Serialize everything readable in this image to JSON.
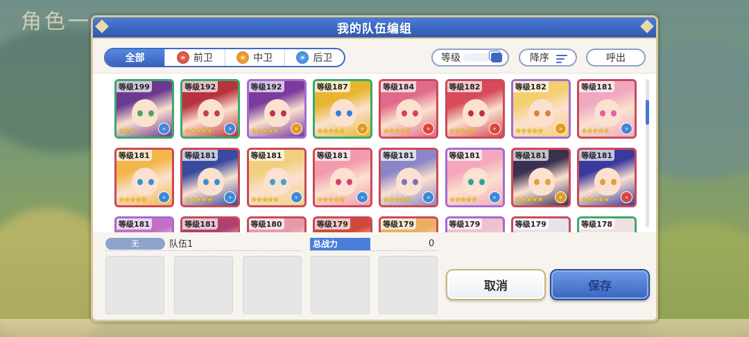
{
  "background_title": "角色一",
  "dialog": {
    "title": "我的队伍编组"
  },
  "tabs": [
    {
      "label": "全部",
      "active": true,
      "icon": ""
    },
    {
      "label": "前卫",
      "active": false,
      "icon": "front-role-icon"
    },
    {
      "label": "中卫",
      "active": false,
      "icon": "mid-role-icon"
    },
    {
      "label": "后卫",
      "active": false,
      "icon": "back-role-icon"
    }
  ],
  "sort": {
    "level_label": "等级",
    "order_label": "降序",
    "recall_label": "呼出"
  },
  "characters": [
    {
      "level": "等级199",
      "stars": "★★★",
      "frame": "green",
      "role": "back"
    },
    {
      "level": "等级192",
      "stars": "★★★★★",
      "frame": "green",
      "role": "back"
    },
    {
      "level": "等级192",
      "stars": "★★★★★",
      "frame": "purple",
      "role": "mid"
    },
    {
      "level": "等级187",
      "stars": "★★★★★",
      "frame": "green",
      "role": "mid"
    },
    {
      "level": "等级184",
      "stars": "★★★★★",
      "frame": "red",
      "role": "front"
    },
    {
      "level": "等级182",
      "stars": "★★★★★",
      "frame": "red",
      "role": "front"
    },
    {
      "level": "等级182",
      "stars": "★★★★★",
      "frame": "purple",
      "role": "mid"
    },
    {
      "level": "等级181",
      "stars": "★★★★★",
      "frame": "red",
      "role": "back"
    },
    {
      "level": "等级181",
      "stars": "★★★★★",
      "frame": "red",
      "role": "back"
    },
    {
      "level": "等级181",
      "stars": "★★★★★",
      "frame": "red",
      "role": "back"
    },
    {
      "level": "等级181",
      "stars": "★★★★★",
      "frame": "red",
      "role": "back"
    },
    {
      "level": "等级181",
      "stars": "★★★★★",
      "frame": "red",
      "role": "back"
    },
    {
      "level": "等级181",
      "stars": "★★★★★",
      "frame": "red",
      "role": "back"
    },
    {
      "level": "等级181",
      "stars": "★★★★★",
      "frame": "purple",
      "role": "back"
    },
    {
      "level": "等级181",
      "stars": "★★★★★",
      "frame": "red",
      "role": "mid"
    },
    {
      "level": "等级181",
      "stars": "★★★★★",
      "frame": "red",
      "role": "front"
    },
    {
      "level": "等级181",
      "stars": "",
      "frame": "purple",
      "role": ""
    },
    {
      "level": "等级181",
      "stars": "",
      "frame": "red",
      "role": ""
    },
    {
      "level": "等级180",
      "stars": "",
      "frame": "red",
      "role": ""
    },
    {
      "level": "等级179",
      "stars": "",
      "frame": "red",
      "role": ""
    },
    {
      "level": "等级179",
      "stars": "",
      "frame": "red",
      "role": ""
    },
    {
      "level": "等级179",
      "stars": "",
      "frame": "purple",
      "role": ""
    },
    {
      "level": "等级179",
      "stars": "",
      "frame": "red",
      "role": ""
    },
    {
      "level": "等级178",
      "stars": "",
      "frame": "green",
      "role": ""
    }
  ],
  "team": {
    "tag": "无",
    "name": "队伍1",
    "power_label": "总战力",
    "power_value": "0"
  },
  "buttons": {
    "cancel": "取消",
    "save": "保存"
  }
}
